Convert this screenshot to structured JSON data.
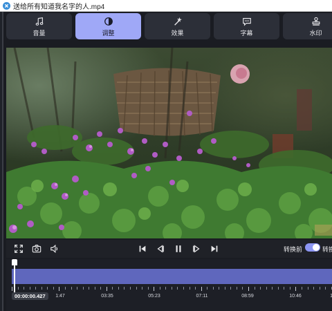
{
  "window": {
    "title": "送给所有知道我名字的人.mp4"
  },
  "tabs": [
    {
      "label": "音量",
      "icon": "music-note-icon",
      "active": false
    },
    {
      "label": "调整",
      "icon": "contrast-icon",
      "active": true
    },
    {
      "label": "效果",
      "icon": "magic-wand-icon",
      "active": false
    },
    {
      "label": "字幕",
      "icon": "speech-bubble-icon",
      "active": false
    },
    {
      "label": "水印",
      "icon": "stamp-icon",
      "active": false
    }
  ],
  "controls": {
    "left_icons": [
      "fullscreen-icon",
      "camera-icon",
      "volume-icon"
    ],
    "center_icons": [
      "skip-start-icon",
      "frame-back-icon",
      "pause-icon",
      "frame-forward-icon",
      "skip-end-icon"
    ],
    "toggle_before_label": "转换前",
    "toggle_after_label": "转换",
    "toggle_on": true
  },
  "timeline": {
    "current_time": "00:00:00.427",
    "tick_labels": [
      "1:47",
      "03:35",
      "05:23",
      "07:11",
      "08:59",
      "10:46",
      "12"
    ],
    "colors": {
      "track": "#5f67bd",
      "accent": "#9fa8f7"
    }
  }
}
